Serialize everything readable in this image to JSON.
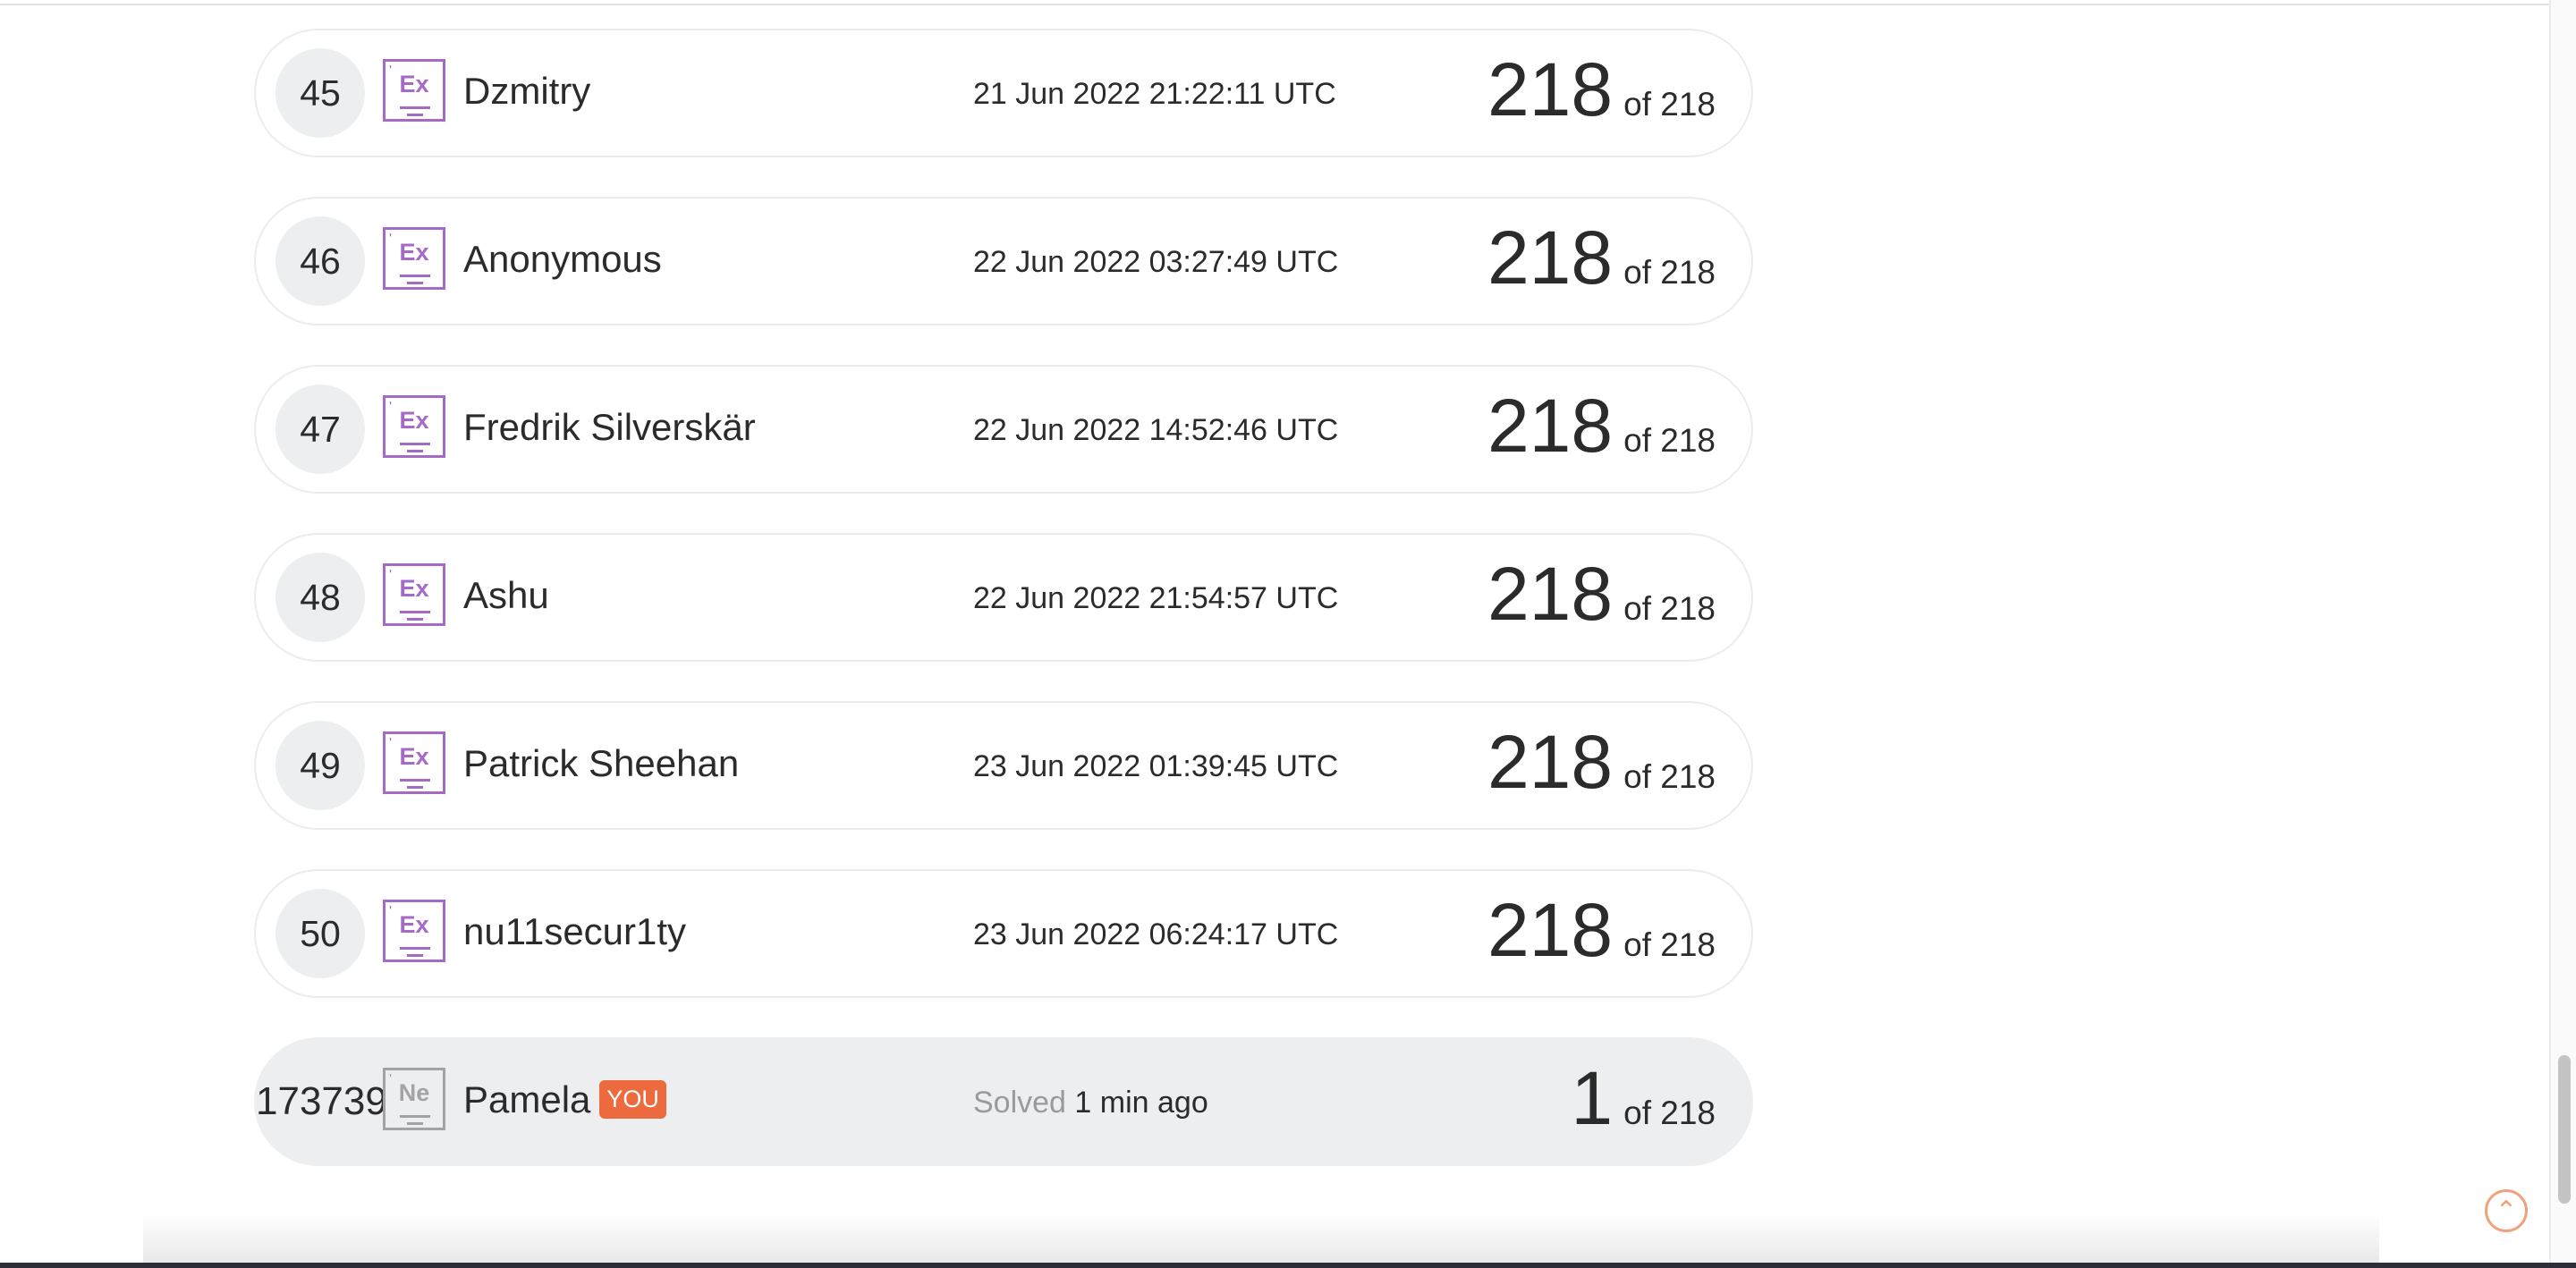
{
  "rows": [
    {
      "rank": "45",
      "badge": "Ex",
      "name": "Dzmitry",
      "time": "21 Jun 2022 21:22:11 UTC",
      "score": "218",
      "of": "of 218"
    },
    {
      "rank": "46",
      "badge": "Ex",
      "name": "Anonymous",
      "time": "22 Jun 2022 03:27:49 UTC",
      "score": "218",
      "of": "of 218"
    },
    {
      "rank": "47",
      "badge": "Ex",
      "name": "Fredrik Silverskär",
      "time": "22 Jun 2022 14:52:46 UTC",
      "score": "218",
      "of": "of 218"
    },
    {
      "rank": "48",
      "badge": "Ex",
      "name": "Ashu",
      "time": "22 Jun 2022 21:54:57 UTC",
      "score": "218",
      "of": "of 218"
    },
    {
      "rank": "49",
      "badge": "Ex",
      "name": "Patrick Sheehan",
      "time": "23 Jun 2022 01:39:45 UTC",
      "score": "218",
      "of": "of 218"
    },
    {
      "rank": "50",
      "badge": "Ex",
      "name": "nu11secur1ty",
      "time": "23 Jun 2022 06:24:17 UTC",
      "score": "218",
      "of": "of 218"
    }
  ],
  "you": {
    "rank": "173739",
    "badge": "Ne",
    "name": "Pamela",
    "tag": "YOU",
    "solved_label": "Solved",
    "solved_when": "1 min ago",
    "score": "1",
    "of": "of 218"
  },
  "colors": {
    "expert_badge": "#a569c6",
    "novice_badge": "#a3a3a3",
    "you_tag": "#ed6a3e",
    "you_row_bg": "#eceef0"
  },
  "icons": {
    "scroll_top": "chevron-up-circle-icon",
    "level_badge": "level-badge-icon"
  }
}
